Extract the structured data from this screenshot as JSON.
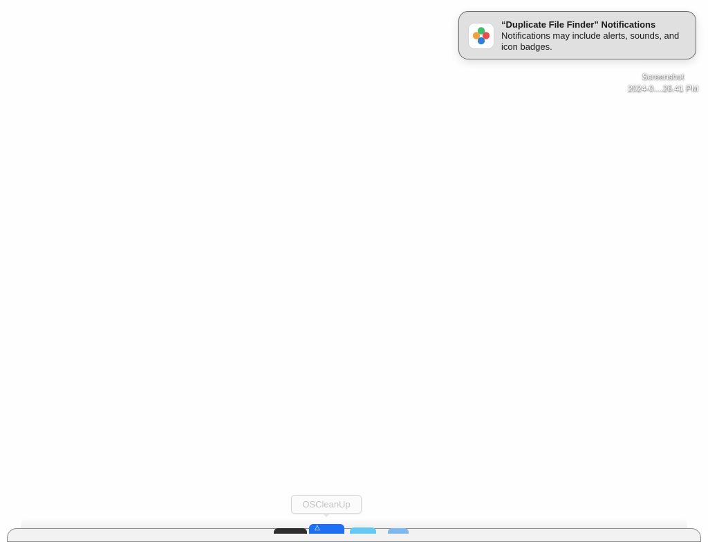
{
  "notification": {
    "title": "“Duplicate File Finder” Notifications",
    "body": "Notifications may include alerts, sounds, and icon badges.",
    "icon": "duplicate-file-finder-app-icon",
    "icon_colors": [
      "#3fbf6f",
      "#f0a13a",
      "#e84c4c",
      "#2f7fd6"
    ]
  },
  "desktop_file": {
    "name": "Screenshot",
    "date": "2024-0....26.41 PM"
  },
  "dock": {
    "tooltip": "OSCleanUp",
    "apps": [
      {
        "name": "dark-app-icon",
        "color": "#2e2e2e"
      },
      {
        "name": "oscleanup-app-icon",
        "color": "#1f6ff2"
      },
      {
        "name": "cyan-app-icon",
        "color": "#66c9f3"
      },
      {
        "name": "light-blue-app-icon",
        "color": "#7eb8ec"
      }
    ]
  }
}
